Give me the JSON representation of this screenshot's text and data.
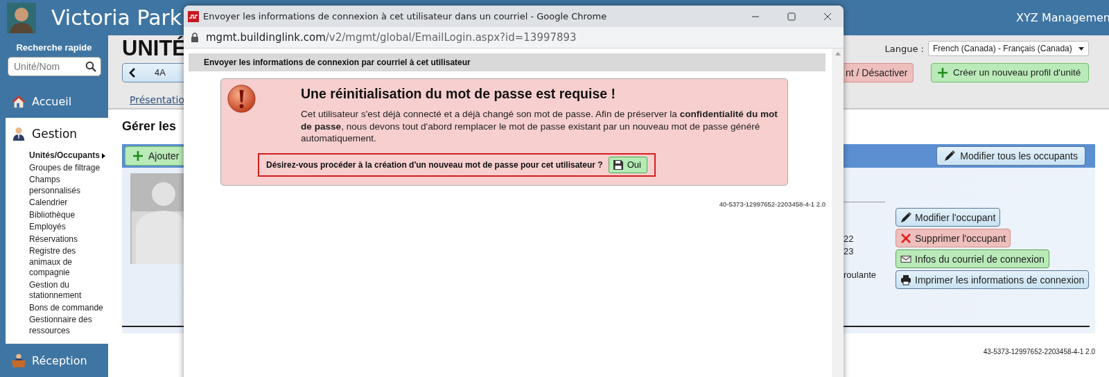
{
  "header": {
    "site_name": "Victoria Park",
    "company": "XYZ Managemen"
  },
  "sidebar": {
    "search_label": "Recherche rapide",
    "search": {
      "placeholder": "Unité/Nom"
    },
    "sections": [
      {
        "label": "Accueil",
        "expanded": false
      },
      {
        "label": "Gestion",
        "expanded": true,
        "items": [
          {
            "label": "Unités/Occupants",
            "selected": true
          },
          {
            "label": "Groupes de filtrage",
            "selected": false
          },
          {
            "label": "Champs personnalisés",
            "selected": false
          },
          {
            "label": "Calendrier",
            "selected": false
          },
          {
            "label": "Bibliothèque",
            "selected": false
          },
          {
            "label": "Employés",
            "selected": false
          },
          {
            "label": "Réservations",
            "selected": false
          },
          {
            "label": "Registre des animaux de compagnie",
            "selected": false
          },
          {
            "label": "Gestion du stationnement",
            "selected": false
          },
          {
            "label": "Bons de commande",
            "selected": false
          },
          {
            "label": "Gestionnaire des ressources",
            "selected": false
          }
        ]
      },
      {
        "label": "Réception",
        "expanded": false
      }
    ]
  },
  "page": {
    "title": "UNITÉ",
    "language": {
      "label": "Langue :",
      "value": "French (Canada) - Français (Canada)"
    },
    "unit_nav": {
      "value": "4A"
    },
    "buttons": [
      {
        "label": "nt / Désactiver",
        "kind": "danger"
      },
      {
        "label": "Créer un nouveau profil d'unité",
        "kind": "create"
      }
    ],
    "tab_link": "Présentatio",
    "section_title": "Gérer les",
    "toolbar": {
      "add_button": "Ajouter",
      "edit_all_button": "Modifier tous les occupants"
    },
    "occupant": {
      "photo": {
        "kind": "picture"
      },
      "details": [
        "22",
        "23",
        "roulante"
      ],
      "actions": [
        {
          "label": "Modifier l'occupant",
          "kind": "edit"
        },
        {
          "label": "Supprimer l'occupant",
          "kind": "delete"
        },
        {
          "label": "Infos du courriel de connexion",
          "kind": "email"
        },
        {
          "label": "Imprimer les informations de connexion",
          "kind": "print"
        }
      ]
    },
    "version": "43-5373-12997652-2203458-4-1 2.0"
  },
  "popup": {
    "title": "Envoyer les informations de connexion à cet utilisateur dans un courriel - Google Chrome",
    "url_host": "mgmt.buildinglink.com",
    "url_path": "/v2/mgmt/global/EmailLogin.aspx?id=13997893",
    "header": "Envoyer les informations de connexion par courriel à cet utilisateur",
    "alert": {
      "title": "Une réinitialisation du mot de passe est requise !",
      "message": "Cet utilisateur s'est déjà connecté et a déjà changé son mot de passe. Afin de préserver la **confidentialité du mot de passe**, nous devons tout d'abord remplacer le mot de passe existant par un nouveau mot de passe généré automatiquement.",
      "question": "Désirez-vous procéder à la création d'un nouveau mot de passe pour cet utilisateur ?",
      "confirm_button": "Oui"
    },
    "version": "40-5373-12997652-2203458-4-1 2.0"
  }
}
